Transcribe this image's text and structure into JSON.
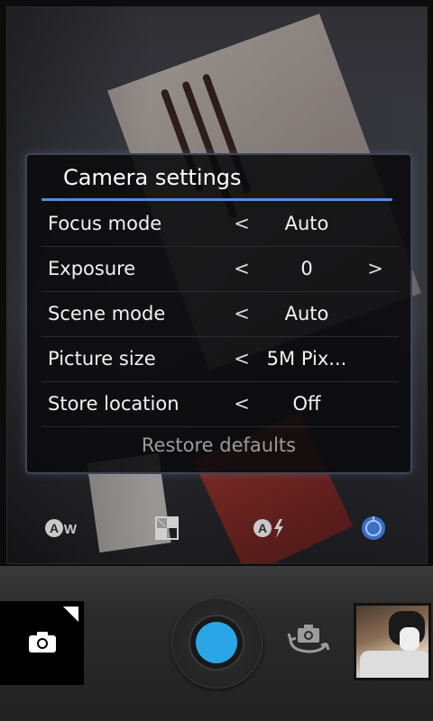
{
  "dialog": {
    "title": "Camera settings",
    "rows": [
      {
        "label": "Focus mode",
        "prev": "<",
        "value": "Auto",
        "next": ""
      },
      {
        "label": "Exposure",
        "prev": "<",
        "value": "0",
        "next": ">"
      },
      {
        "label": "Scene mode",
        "prev": "<",
        "value": "Auto",
        "next": ""
      },
      {
        "label": "Picture size",
        "prev": "<",
        "value": "5M Pix...",
        "next": ""
      },
      {
        "label": "Store location",
        "prev": "<",
        "value": "Off",
        "next": ""
      }
    ],
    "restore_label": "Restore defaults"
  },
  "indicators": [
    "auto-white-balance-icon",
    "color-effect-icon",
    "auto-flash-icon",
    "settings-active-icon"
  ],
  "controls": {
    "mode_icon": "camera-icon",
    "shutter_color": "#2aa6e6",
    "switch_icon": "switch-camera-icon",
    "thumbnail": "gallery-thumbnail"
  },
  "colors": {
    "accent": "#4f8fe6",
    "shutter": "#2aa6e6"
  }
}
